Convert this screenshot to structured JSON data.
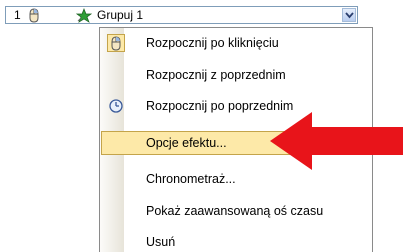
{
  "row": {
    "number": "1",
    "mouse_icon": "mouse-icon",
    "effect_icon": "star-effect-icon",
    "name": "Grupuj 1",
    "dropdown_icon": "chevron-down-icon"
  },
  "menu": {
    "items": [
      {
        "label": "Rozpocznij po kliknięciu",
        "icon": "mouse-icon",
        "checked": true
      },
      {
        "label": "Rozpocznij z poprzednim",
        "icon": ""
      },
      {
        "label": "Rozpocznij po poprzednim",
        "icon": "clock-icon"
      },
      {
        "label": "Opcje efektu...",
        "icon": "",
        "highlighted": true
      },
      {
        "label": "Chronometraż...",
        "icon": ""
      },
      {
        "label": "Pokaż zaawansowaną oś czasu",
        "icon": ""
      },
      {
        "label": "Usuń",
        "icon": ""
      }
    ]
  },
  "annotation": {
    "arrow_color": "#e8141a",
    "icon": "red-arrow-icon"
  },
  "colors": {
    "highlight": "#fde9a8",
    "highlight_border": "#c4a44a",
    "border": "#7f9db9"
  }
}
